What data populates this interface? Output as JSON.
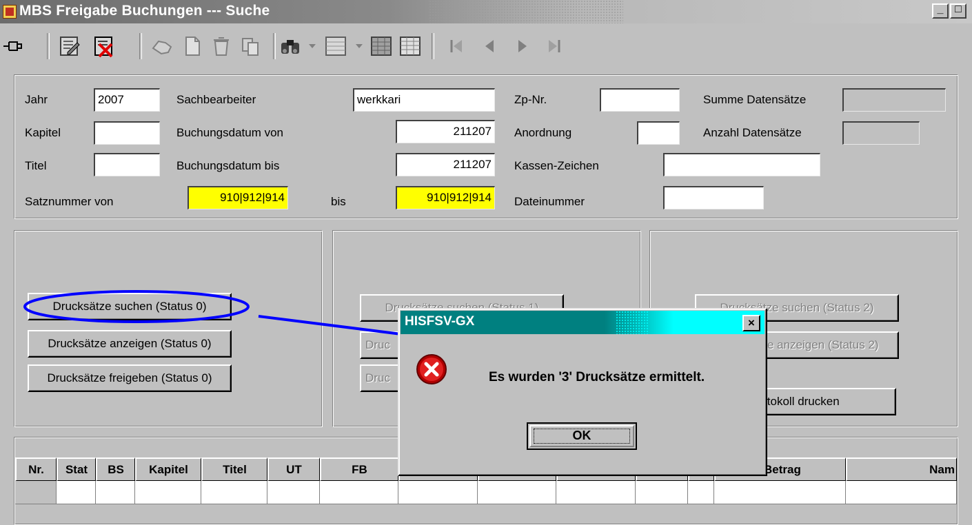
{
  "window": {
    "title": "MBS Freigabe Buchungen --- Suche",
    "minimize_label": "_",
    "maximize_label": "□"
  },
  "toolbar": {
    "icons": [
      "pin-icon",
      "edit-record-icon",
      "delete-record-icon",
      "hand-icon",
      "new-document-icon",
      "trash-icon",
      "copy-icon",
      "binoculars-icon",
      "grid-icon",
      "grid-export-icon",
      "table-icon",
      "first-record-icon",
      "previous-record-icon",
      "next-record-icon",
      "last-record-icon"
    ]
  },
  "search": {
    "jahr_label": "Jahr",
    "jahr_value": "2007",
    "kapitel_label": "Kapitel",
    "kapitel_value": "",
    "titel_label": "Titel",
    "titel_value": "",
    "satznummer_von_label": "Satznummer von",
    "satznummer_von_value": "910|912|914",
    "sachbearbeiter_label": "Sachbearbeiter",
    "sachbearbeiter_value": "werkkari",
    "buchungsdatum_von_label": "Buchungsdatum von",
    "buchungsdatum_von_value": "211207",
    "buchungsdatum_bis_label": "Buchungsdatum bis",
    "buchungsdatum_bis_value": "211207",
    "bis_label": "bis",
    "bis_value": "910|912|914",
    "zp_nr_label": "Zp-Nr.",
    "zp_nr_value": "",
    "anordnung_label": "Anordnung",
    "anordnung_value": "",
    "kassen_zeichen_label": "Kassen-Zeichen",
    "kassen_zeichen_value": "",
    "dateinummer_label": "Dateinummer",
    "dateinummer_value": "",
    "summe_label": "Summe Datensätze",
    "summe_value": "",
    "anzahl_label": "Anzahl Datensätze",
    "anzahl_value": ""
  },
  "actions": {
    "status0": {
      "suchen": "Drucksätze suchen (Status 0)",
      "anzeigen": "Drucksätze anzeigen (Status 0)",
      "freigeben": "Drucksätze freigeben (Status 0)"
    },
    "status1": {
      "suchen": "Drucksätze suchen (Status 1)",
      "anzeigen": "Druc",
      "freigeben": "Druc"
    },
    "status2": {
      "suchen": "Drucksätze suchen (Status 2)",
      "anzeigen": "Drucksätze anzeigen (Status 2)",
      "protokoll": "Protokoll drucken"
    }
  },
  "table": {
    "columns": [
      "Nr.",
      "Stat",
      "BS",
      "Kapitel",
      "Titel",
      "UT",
      "FB",
      "",
      "",
      "",
      "",
      "",
      "Betrag",
      "Nam"
    ],
    "rows": [
      [
        "",
        "",
        "",
        "",
        "",
        "",
        "",
        "",
        "",
        "",
        "",
        "",
        "",
        ""
      ]
    ]
  },
  "dialog": {
    "title": "HISFSV-GX",
    "close_label": "×",
    "message": "Es wurden  '3'  Drucksätze ermittelt.",
    "ok_label": "OK",
    "icon": "error-icon"
  },
  "annotation": {
    "color": "#0000ff"
  }
}
